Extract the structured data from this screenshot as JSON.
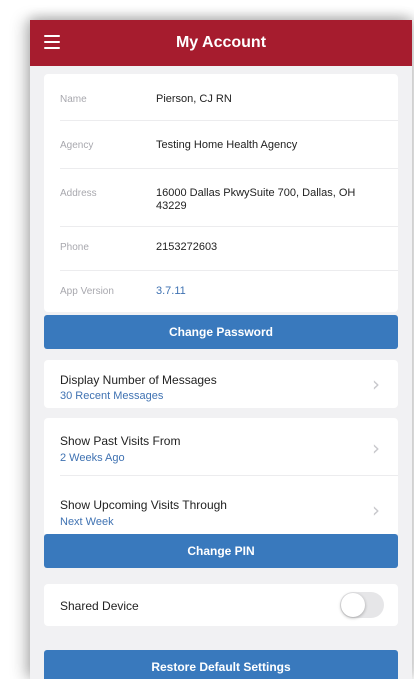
{
  "header": {
    "title": "My Account",
    "menu_icon": "hamburger-menu-icon"
  },
  "account_info": {
    "name_label": "Name",
    "name_value": "Pierson, CJ RN",
    "agency_label": "Agency",
    "agency_value": "Testing Home Health Agency",
    "address_label": "Address",
    "address_value": "16000 Dallas PkwySuite 700, Dallas, OH 43229",
    "phone_label": "Phone",
    "phone_value": "2153272603",
    "version_label": "App Version",
    "version_value": "3.7.11"
  },
  "change_password_label": "Change Password",
  "messages_setting": {
    "title": "Display Number of Messages",
    "value": "30 Recent Messages"
  },
  "visits_settings": {
    "past": {
      "title": "Show Past Visits From",
      "value": "2 Weeks Ago"
    },
    "upcoming": {
      "title": "Show Upcoming Visits Through",
      "value": "Next Week"
    }
  },
  "change_pin_label": "Change PIN",
  "shared_device": {
    "label": "Shared Device",
    "enabled": false
  },
  "restore_defaults_label": "Restore Default Settings",
  "colors": {
    "header": "#a61c2e",
    "button": "#3979bd",
    "link": "#3f72b2",
    "background": "#f1f1f3"
  }
}
